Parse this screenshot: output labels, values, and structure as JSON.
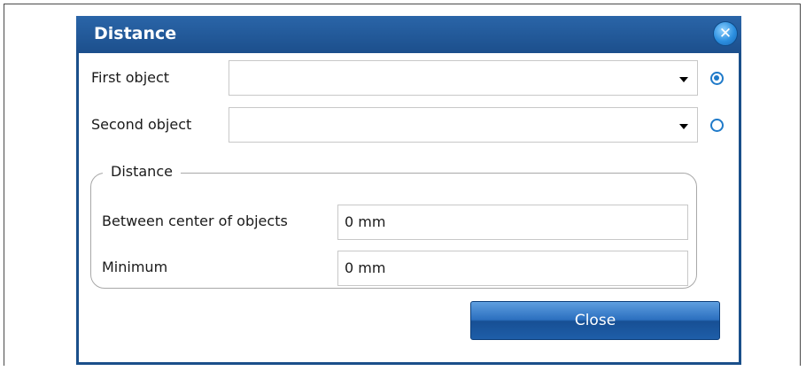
{
  "dialog": {
    "title": "Distance",
    "close_icon_glyph": "✕"
  },
  "first_object": {
    "label": "First object",
    "value": "",
    "selected": true
  },
  "second_object": {
    "label": "Second object",
    "value": "",
    "selected": false
  },
  "distance_group": {
    "legend": "Distance",
    "between_center_label": "Between center of objects",
    "between_center_value": "0 mm",
    "minimum_label": "Minimum",
    "minimum_value": "0 mm"
  },
  "buttons": {
    "close_label": "Close"
  },
  "colors": {
    "title_bar": "#1c4f8c",
    "accent": "#1f7ac9",
    "button": "#2b6fbf"
  }
}
